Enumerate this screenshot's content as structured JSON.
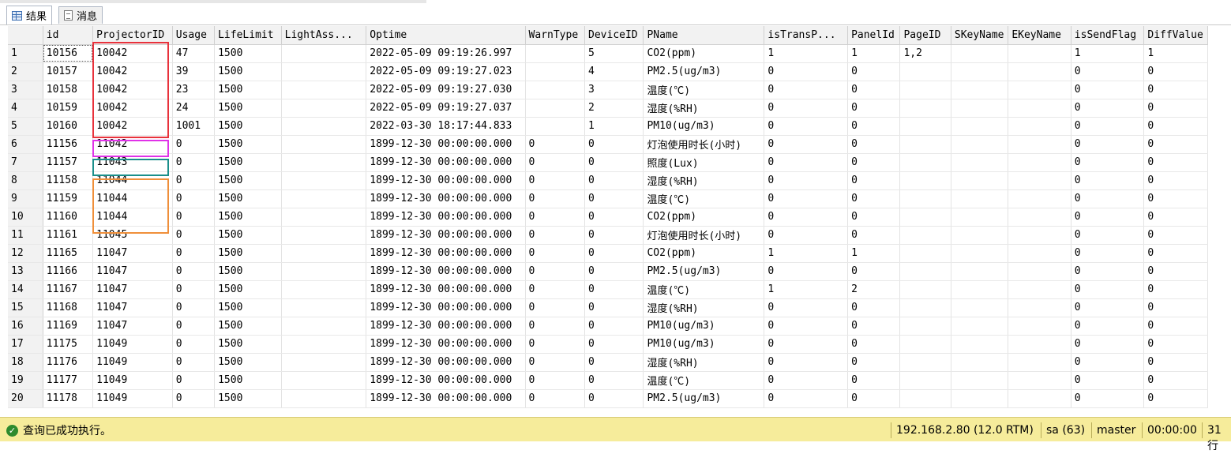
{
  "tabs": [
    {
      "label": "结果",
      "icon": "grid-icon",
      "active": true
    },
    {
      "label": "消息",
      "icon": "message-icon",
      "active": false
    }
  ],
  "columns": [
    "",
    "id",
    "ProjectorID",
    "Usage",
    "LifeLimit",
    "LightAss...",
    "Optime",
    "WarnType",
    "DeviceID",
    "PName",
    "isTransP...",
    "PanelId",
    "PageID",
    "SKeyName",
    "EKeyName",
    "isSendFlag",
    "DiffValue"
  ],
  "rows": [
    [
      "1",
      "10156",
      "10042",
      "47",
      "1500",
      "",
      "2022-05-09 09:19:26.997",
      "",
      "5",
      "CO2(ppm)",
      "1",
      "1",
      "1,2",
      "",
      "",
      "1",
      "1"
    ],
    [
      "2",
      "10157",
      "10042",
      "39",
      "1500",
      "",
      "2022-05-09 09:19:27.023",
      "",
      "4",
      "PM2.5(ug/m3)",
      "0",
      "0",
      "",
      "",
      "",
      "0",
      "0"
    ],
    [
      "3",
      "10158",
      "10042",
      "23",
      "1500",
      "",
      "2022-05-09 09:19:27.030",
      "",
      "3",
      "温度(℃)",
      "0",
      "0",
      "",
      "",
      "",
      "0",
      "0"
    ],
    [
      "4",
      "10159",
      "10042",
      "24",
      "1500",
      "",
      "2022-05-09 09:19:27.037",
      "",
      "2",
      "湿度(%RH)",
      "0",
      "0",
      "",
      "",
      "",
      "0",
      "0"
    ],
    [
      "5",
      "10160",
      "10042",
      "1001",
      "1500",
      "",
      "2022-03-30 18:17:44.833",
      "",
      "1",
      "PM10(ug/m3)",
      "0",
      "0",
      "",
      "",
      "",
      "0",
      "0"
    ],
    [
      "6",
      "11156",
      "11042",
      "0",
      "1500",
      "",
      "1899-12-30 00:00:00.000",
      "0",
      "0",
      "灯泡使用时长(小时)",
      "0",
      "0",
      "",
      "",
      "",
      "0",
      "0"
    ],
    [
      "7",
      "11157",
      "11043",
      "0",
      "1500",
      "",
      "1899-12-30 00:00:00.000",
      "0",
      "0",
      "照度(Lux)",
      "0",
      "0",
      "",
      "",
      "",
      "0",
      "0"
    ],
    [
      "8",
      "11158",
      "11044",
      "0",
      "1500",
      "",
      "1899-12-30 00:00:00.000",
      "0",
      "0",
      "湿度(%RH)",
      "0",
      "0",
      "",
      "",
      "",
      "0",
      "0"
    ],
    [
      "9",
      "11159",
      "11044",
      "0",
      "1500",
      "",
      "1899-12-30 00:00:00.000",
      "0",
      "0",
      "温度(℃)",
      "0",
      "0",
      "",
      "",
      "",
      "0",
      "0"
    ],
    [
      "10",
      "11160",
      "11044",
      "0",
      "1500",
      "",
      "1899-12-30 00:00:00.000",
      "0",
      "0",
      "CO2(ppm)",
      "0",
      "0",
      "",
      "",
      "",
      "0",
      "0"
    ],
    [
      "11",
      "11161",
      "11045",
      "0",
      "1500",
      "",
      "1899-12-30 00:00:00.000",
      "0",
      "0",
      "灯泡使用时长(小时)",
      "0",
      "0",
      "",
      "",
      "",
      "0",
      "0"
    ],
    [
      "12",
      "11165",
      "11047",
      "0",
      "1500",
      "",
      "1899-12-30 00:00:00.000",
      "0",
      "0",
      "CO2(ppm)",
      "1",
      "1",
      "",
      "",
      "",
      "0",
      "0"
    ],
    [
      "13",
      "11166",
      "11047",
      "0",
      "1500",
      "",
      "1899-12-30 00:00:00.000",
      "0",
      "0",
      "PM2.5(ug/m3)",
      "0",
      "0",
      "",
      "",
      "",
      "0",
      "0"
    ],
    [
      "14",
      "11167",
      "11047",
      "0",
      "1500",
      "",
      "1899-12-30 00:00:00.000",
      "0",
      "0",
      "温度(℃)",
      "1",
      "2",
      "",
      "",
      "",
      "0",
      "0"
    ],
    [
      "15",
      "11168",
      "11047",
      "0",
      "1500",
      "",
      "1899-12-30 00:00:00.000",
      "0",
      "0",
      "湿度(%RH)",
      "0",
      "0",
      "",
      "",
      "",
      "0",
      "0"
    ],
    [
      "16",
      "11169",
      "11047",
      "0",
      "1500",
      "",
      "1899-12-30 00:00:00.000",
      "0",
      "0",
      "PM10(ug/m3)",
      "0",
      "0",
      "",
      "",
      "",
      "0",
      "0"
    ],
    [
      "17",
      "11175",
      "11049",
      "0",
      "1500",
      "",
      "1899-12-30 00:00:00.000",
      "0",
      "0",
      "PM10(ug/m3)",
      "0",
      "0",
      "",
      "",
      "",
      "0",
      "0"
    ],
    [
      "18",
      "11176",
      "11049",
      "0",
      "1500",
      "",
      "1899-12-30 00:00:00.000",
      "0",
      "0",
      "湿度(%RH)",
      "0",
      "0",
      "",
      "",
      "",
      "0",
      "0"
    ],
    [
      "19",
      "11177",
      "11049",
      "0",
      "1500",
      "",
      "1899-12-30 00:00:00.000",
      "0",
      "0",
      "温度(℃)",
      "0",
      "0",
      "",
      "",
      "",
      "0",
      "0"
    ],
    [
      "20",
      "11178",
      "11049",
      "0",
      "1500",
      "",
      "1899-12-30 00:00:00.000",
      "0",
      "0",
      "PM2.5(ug/m3)",
      "0",
      "0",
      "",
      "",
      "",
      "0",
      "0"
    ]
  ],
  "status": {
    "message": "查询已成功执行。",
    "server": "192.168.2.80 (12.0 RTM)",
    "user": "sa (63)",
    "database": "master",
    "elapsed": "00:00:00",
    "rows": "31 行"
  },
  "colors": {
    "highlight_red": "#e8323c",
    "highlight_magenta": "#e032e8",
    "highlight_teal": "#1a8f8b",
    "highlight_orange": "#ef8f3a",
    "statusbar": "#f6ec9b"
  }
}
